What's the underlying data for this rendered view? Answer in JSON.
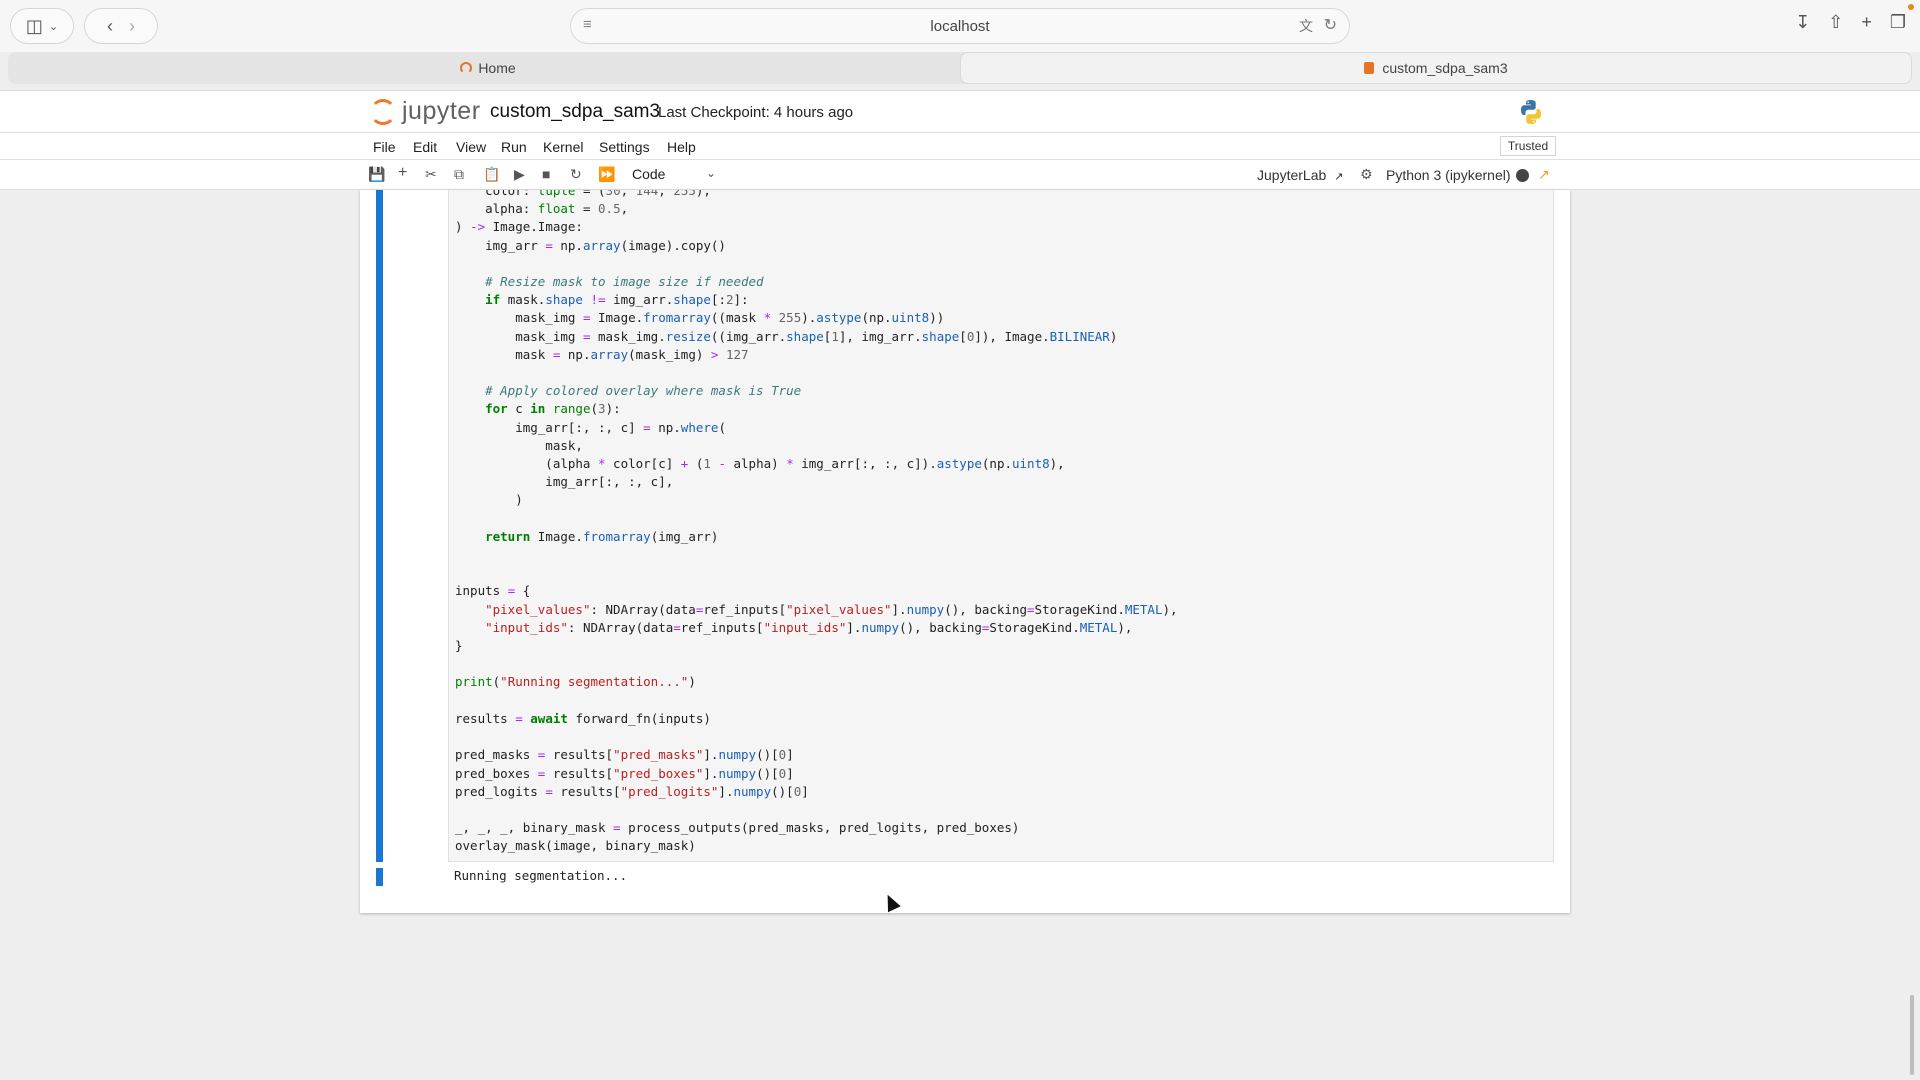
{
  "browser": {
    "url": "localhost",
    "tabs": [
      {
        "label": "Home"
      },
      {
        "label": "custom_sdpa_sam3"
      }
    ]
  },
  "jupyter": {
    "logo_text": "jupyter",
    "notebook_name": "custom_sdpa_sam3",
    "checkpoint": "Last Checkpoint: 4 hours ago",
    "trusted": "Trusted",
    "menu": [
      "File",
      "Edit",
      "View",
      "Run",
      "Kernel",
      "Settings",
      "Help"
    ],
    "toolbar": {
      "cell_type": "Code",
      "jupyterlab_link": "JupyterLab",
      "kernel_name": "Python 3 (ipykernel)"
    }
  },
  "cell": {
    "output": "Running segmentation..."
  },
  "colors": {
    "cell_active_bar": "#1976d2",
    "jupyter_orange": "#f37726"
  }
}
